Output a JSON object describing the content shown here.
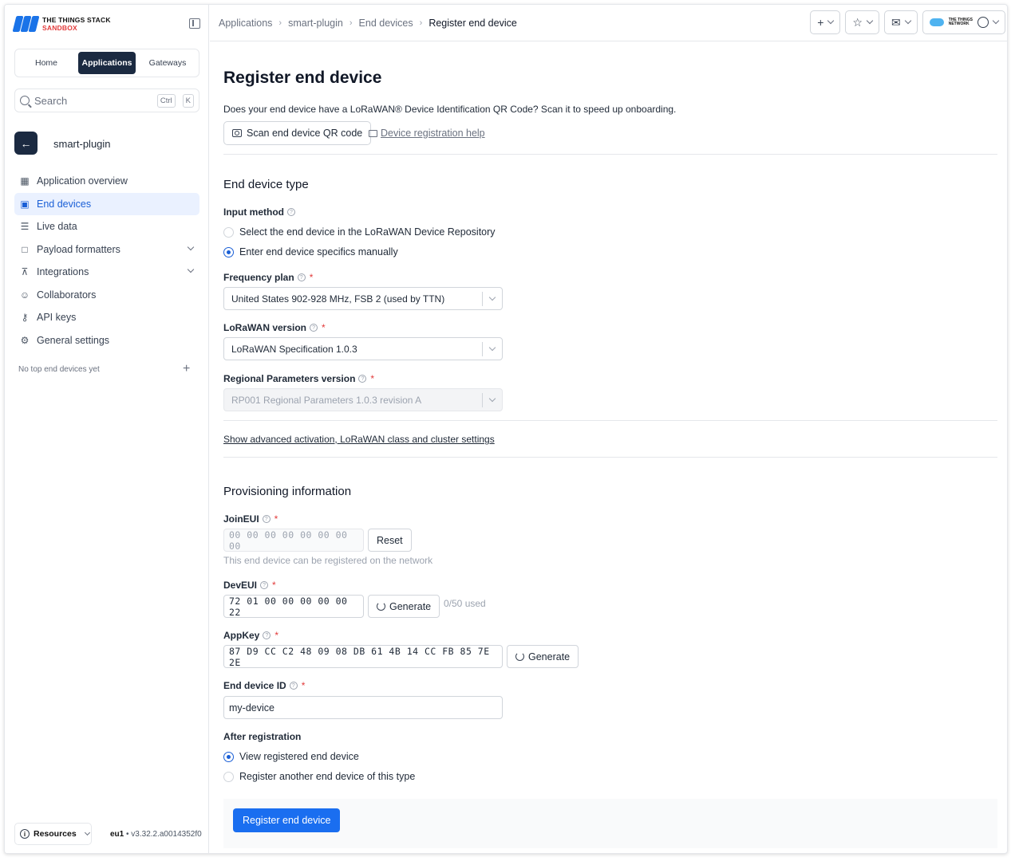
{
  "brand": {
    "line1": "THE THINGS STACK",
    "line2": "SANDBOX"
  },
  "switcher": {
    "home": "Home",
    "applications": "Applications",
    "gateways": "Gateways"
  },
  "search": {
    "placeholder": "Search",
    "kbd1": "Ctrl",
    "kbd2": "K"
  },
  "app": {
    "name": "smart-plugin"
  },
  "nav": [
    {
      "label": "Application overview",
      "icon": "grid-icon"
    },
    {
      "label": "End devices",
      "icon": "chip-icon"
    },
    {
      "label": "Live data",
      "icon": "list-icon"
    },
    {
      "label": "Payload formatters",
      "icon": "code-icon"
    },
    {
      "label": "Integrations",
      "icon": "fork-icon"
    },
    {
      "label": "Collaborators",
      "icon": "users-icon"
    },
    {
      "label": "API keys",
      "icon": "key-icon"
    },
    {
      "label": "General settings",
      "icon": "gear-icon"
    }
  ],
  "top_devices": {
    "empty": "No top end devices yet"
  },
  "resources": {
    "label": "Resources"
  },
  "version": {
    "region": "eu1",
    "text": " • v3.32.2.a0014352f0"
  },
  "breadcrumb": [
    "Applications",
    "smart-plugin",
    "End devices",
    "Register end device"
  ],
  "page": {
    "title": "Register end device",
    "qr_text": "Does your end device have a LoRaWAN® Device Identification QR Code? Scan it to speed up onboarding.",
    "scan_btn": "Scan end device QR code",
    "help_link": "Device registration help"
  },
  "type": {
    "title": "End device type",
    "input_method_label": "Input method",
    "opt_repo": "Select the end device in the LoRaWAN Device Repository",
    "opt_manual": "Enter end device specifics manually",
    "freq_label": "Frequency plan",
    "freq_value": "United States 902-928 MHz, FSB 2 (used by TTN)",
    "lorawan_label": "LoRaWAN version",
    "lorawan_value": "LoRaWAN Specification 1.0.3",
    "regional_label": "Regional Parameters version",
    "regional_value": "RP001 Regional Parameters 1.0.3 revision A",
    "adv_link": "Show advanced activation, LoRaWAN class and cluster settings"
  },
  "prov": {
    "title": "Provisioning information",
    "joineui_label": "JoinEUI",
    "joineui_value": "00 00 00 00 00 00 00 00",
    "reset_btn": "Reset",
    "joineui_hint": "This end device can be registered on the network",
    "deveui_label": "DevEUI",
    "deveui_value": "72 01 00 00 00 00 00 22",
    "generate_btn": "Generate",
    "used": "0/50 used",
    "appkey_label": "AppKey",
    "appkey_value": "87 D9 CC C2 48 09 08 DB 61 4B 14 CC FB 85 7E 2E",
    "device_id_label": "End device ID",
    "device_id_value": "my-device",
    "after_label": "After registration",
    "after_view": "View registered end device",
    "after_another": "Register another end device of this type"
  },
  "submit": "Register end device",
  "colors": {
    "accent": "#1a6ef0",
    "dark": "#1b2a41",
    "required": "#e23a3a"
  }
}
